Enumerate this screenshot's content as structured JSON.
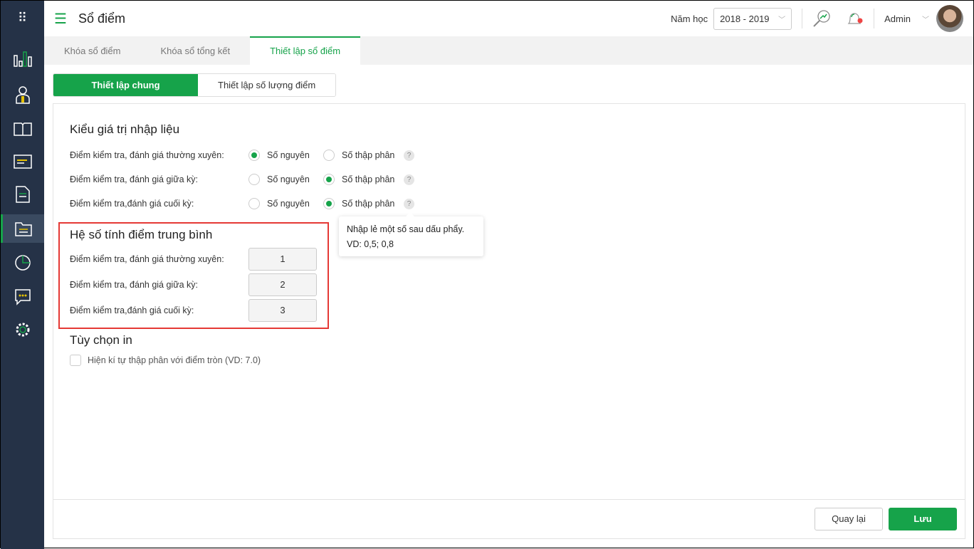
{
  "header": {
    "title": "Sổ điểm",
    "year_label": "Năm học",
    "year_value": "2018 - 2019",
    "user": "Admin"
  },
  "tabs": [
    "Khóa sổ điểm",
    "Khóa sổ tổng kết",
    "Thiết lập sổ điểm"
  ],
  "subtabs": [
    "Thiết lập chung",
    "Thiết lập số lượng điểm"
  ],
  "input_type": {
    "title": "Kiểu giá trị nhập liệu",
    "option_integer": "Số nguyên",
    "option_decimal": "Số thập phân",
    "help": "?",
    "rows": [
      {
        "label": "Điểm kiểm tra, đánh giá thường xuyên:",
        "selected": "integer"
      },
      {
        "label": "Điểm kiểm tra, đánh giá giữa kỳ:",
        "selected": "decimal"
      },
      {
        "label": "Điểm kiểm tra,đánh giá cuối kỳ:",
        "selected": "decimal"
      }
    ]
  },
  "tooltip": {
    "line1": "Nhập lẻ một số sau dấu phẩy.",
    "line2": "VD: 0,5; 0,8"
  },
  "coefficients": {
    "title": "Hệ số tính điểm trung bình",
    "rows": [
      {
        "label": "Điểm kiểm tra, đánh giá thường xuyên:",
        "value": "1"
      },
      {
        "label": "Điểm kiểm tra, đánh giá giữa kỳ:",
        "value": "2"
      },
      {
        "label": "Điểm kiểm tra,đánh giá cuối kỳ:",
        "value": "3"
      }
    ]
  },
  "print": {
    "title": "Tùy chọn in",
    "checkbox_label": "Hiện kí tự thập phân với điểm tròn (VD: 7.0)",
    "checked": false
  },
  "footer": {
    "back": "Quay lại",
    "save": "Lưu"
  },
  "colors": {
    "accent": "#16a34a",
    "sidebar": "#253247",
    "highlight": "#e53935"
  }
}
